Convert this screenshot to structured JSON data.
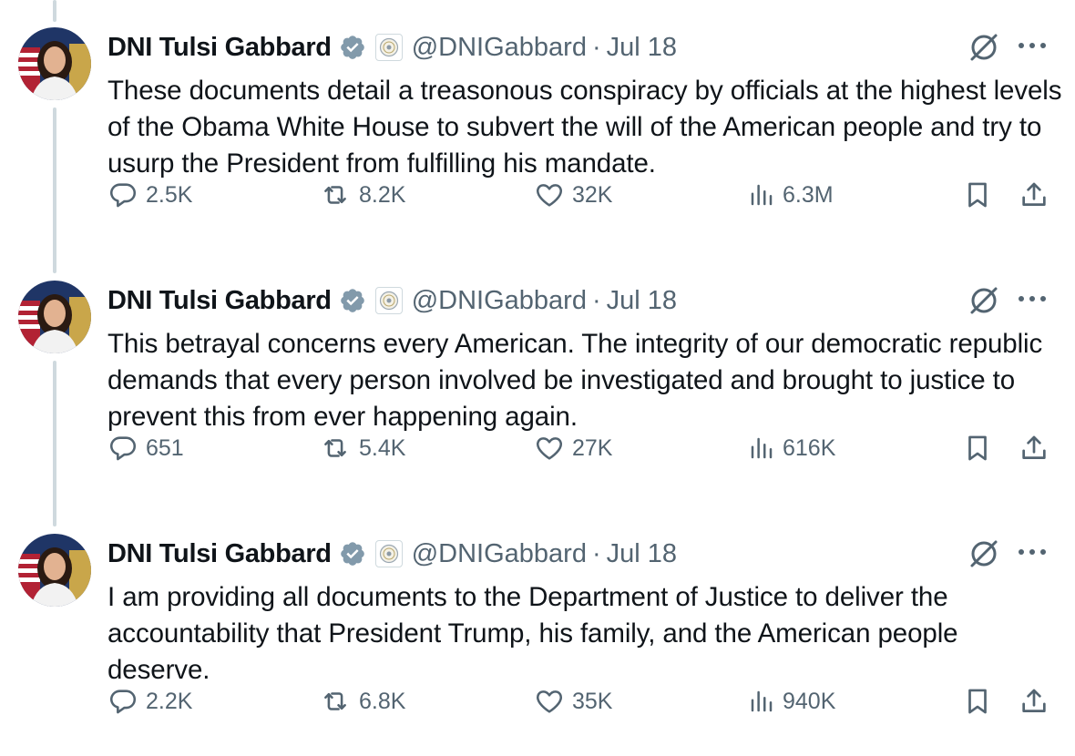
{
  "author": {
    "name": "DNI Tulsi Gabbard",
    "handle": "@DNIGabbard",
    "verified_color": "#829aab"
  },
  "colors": {
    "text": "#0f1419",
    "muted": "#536471",
    "thread_line": "#cfd9de"
  },
  "separator": "·",
  "tweets": [
    {
      "date": "Jul 18",
      "text": "These documents detail a treasonous conspiracy by officials at the highest levels of the Obama White House to subvert the will of the American people and try to usurp the President from fulfilling his mandate.",
      "replies": "2.5K",
      "reposts": "8.2K",
      "likes": "32K",
      "views": "6.3M"
    },
    {
      "date": "Jul 18",
      "text": "This betrayal concerns every American. The integrity of our democratic republic demands that every person involved be investigated and brought to justice to prevent this from ever happening again.",
      "replies": "651",
      "reposts": "5.4K",
      "likes": "27K",
      "views": "616K"
    },
    {
      "date": "Jul 18",
      "text": "I am providing all documents to the Department of Justice to deliver the accountability that President Trump, his family, and the American people deserve.",
      "replies": "2.2K",
      "reposts": "6.8K",
      "likes": "35K",
      "views": "940K"
    }
  ]
}
